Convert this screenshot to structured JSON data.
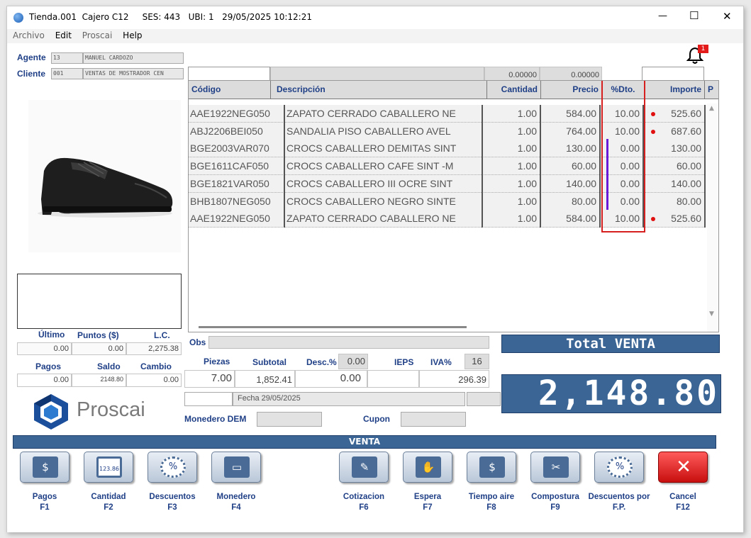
{
  "titlebar": {
    "title": "Tienda.001  Cajero C12     SES: 443   UBI: 1   29/05/2025 10:12:21",
    "minimize": "—",
    "maximize": "☐",
    "close": "✕"
  },
  "menu": [
    "Archivo",
    "Edit",
    "Proscai",
    "Help"
  ],
  "agent": {
    "label": "Agente",
    "code": "13",
    "name": "MANUEL CARDOZO"
  },
  "client": {
    "label": "Cliente",
    "code": "001",
    "name": "VENTAS DE MOSTRADOR CEN"
  },
  "notification": {
    "count": "1"
  },
  "top_values": {
    "v1": "0.00000",
    "v2": "0.00000"
  },
  "grid": {
    "headers": [
      "Código",
      "Descripción",
      "Cantidad",
      "Precio",
      "%Dto.",
      "Importe",
      "P"
    ],
    "rows": [
      {
        "code": "AAE1922NEG050",
        "desc": "ZAPATO CERRADO CABALLERO NE",
        "qty": "1.00",
        "price": "584.00",
        "dto": "10.00",
        "amount": "525.60",
        "mark": "dot"
      },
      {
        "code": "ABJ2206BEI050",
        "desc": "SANDALIA PISO CABALLERO AVEL",
        "qty": "1.00",
        "price": "764.00",
        "dto": "10.00",
        "amount": "687.60",
        "mark": "dot"
      },
      {
        "code": "BGE2003VAR070",
        "desc": "CROCS CABALLERO DEMITAS SINT",
        "qty": "1.00",
        "price": "130.00",
        "dto": "0.00",
        "amount": "130.00",
        "mark": "bar"
      },
      {
        "code": "BGE1611CAF050",
        "desc": "CROCS CABALLERO CAFE SINT -M",
        "qty": "1.00",
        "price": "60.00",
        "dto": "0.00",
        "amount": "60.00",
        "mark": "bar"
      },
      {
        "code": "BGE1821VAR050",
        "desc": "CROCS CABALLERO III OCRE SINT",
        "qty": "1.00",
        "price": "140.00",
        "dto": "0.00",
        "amount": "140.00",
        "mark": "bar"
      },
      {
        "code": "BHB1807NEG050",
        "desc": "CROCS CABALLERO NEGRO SINTE",
        "qty": "1.00",
        "price": "80.00",
        "dto": "0.00",
        "amount": "80.00",
        "mark": "bar"
      },
      {
        "code": "AAE1922NEG050",
        "desc": "ZAPATO CERRADO CABALLERO NE",
        "qty": "1.00",
        "price": "584.00",
        "dto": "10.00",
        "amount": "525.60",
        "mark": "dot"
      }
    ]
  },
  "stats": {
    "ultimo_label": "Último",
    "puntos_label": "Puntos ($)",
    "lc_label": "L.C.",
    "ultimo": "0.00",
    "puntos": "0.00",
    "lc": "2,275.38",
    "pagos_label": "Pagos",
    "saldo_label": "Saldo",
    "cambio_label": "Cambio",
    "pagos": "0.00",
    "saldo": "2148.80",
    "cambio": "0.00"
  },
  "obs_label": "Obs",
  "totals": {
    "piezas_label": "Piezas",
    "subtotal_label": "Subtotal",
    "desc_label": "Desc.%",
    "desc_pct": "0.00",
    "ieps_label": "IEPS",
    "iva_label": "IVA%",
    "iva_pct": "16",
    "piezas": "7.00",
    "subtotal": "1,852.41",
    "desc": "0.00",
    "iva": "296.39"
  },
  "fecha": "Fecha 29/05/2025",
  "monedero_label": "Monedero DEM",
  "cupon_label": "Cupon",
  "total": {
    "label": "Total VENTA",
    "amount": "2,148.80"
  },
  "logo_text": "Proscai",
  "section_label": "VENTA",
  "buttons": [
    {
      "label": "Pagos",
      "key": "F1",
      "icon": "dollar-icon",
      "glyph": "$"
    },
    {
      "label": "Cantidad",
      "key": "F2",
      "icon": "keypad-icon",
      "glyph": "123.86"
    },
    {
      "label": "Descuentos",
      "key": "F3",
      "icon": "percent-badge-icon",
      "glyph": "%"
    },
    {
      "label": "Monedero",
      "key": "F4",
      "icon": "card-icon",
      "glyph": "▭"
    },
    {
      "label": "Cotizacion",
      "key": "F6",
      "icon": "edit-document-icon",
      "glyph": "✎"
    },
    {
      "label": "Espera",
      "key": "F7",
      "icon": "hand-icon",
      "glyph": "✋"
    },
    {
      "label": "Tiempo aire",
      "key": "F8",
      "icon": "phone-dollar-icon",
      "glyph": "$"
    },
    {
      "label": "Compostura",
      "key": "F9",
      "icon": "scissors-icon",
      "glyph": "✂"
    },
    {
      "label": "Descuentos por",
      "label2": "F.P.",
      "icon": "percent-badge-icon",
      "glyph": "%"
    },
    {
      "label": "Cancel",
      "key": "F12",
      "icon": "cancel-x-icon",
      "glyph": "✕"
    }
  ],
  "colors": {
    "brand": "#1f3f86",
    "total_bg": "#3a6595",
    "cancel": "#d81b1b",
    "selection": "#d62020",
    "marker_dot": "#e01010",
    "marker_bar": "#6a1bd8"
  }
}
